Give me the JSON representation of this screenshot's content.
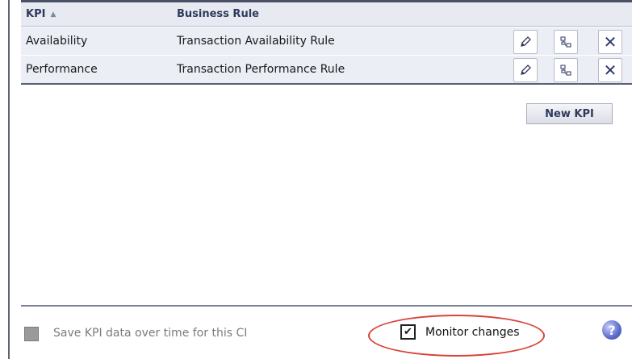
{
  "table": {
    "header": {
      "kpi": "KPI",
      "rule": "Business Rule",
      "sort_glyph": "▲"
    },
    "rows": [
      {
        "kpi": "Availability",
        "rule": "Transaction Availability Rule"
      },
      {
        "kpi": "Performance",
        "rule": "Transaction Performance Rule"
      }
    ],
    "actions": {
      "edit_icon": "pencil-icon",
      "duplicate_icon": "hierarchy-icon",
      "delete_glyph": "✕"
    }
  },
  "new_kpi_label": "New KPI",
  "footer": {
    "save_label": "Save KPI data over time for this CI",
    "save_checked": false,
    "monitor_label": "Monitor changes",
    "monitor_checked": true,
    "monitor_checkmark": "✔",
    "help_glyph": "?"
  },
  "colors": {
    "header_bg": "#e8eaf2",
    "row_bg": "#eceef6",
    "annotation": "#d9433a"
  }
}
